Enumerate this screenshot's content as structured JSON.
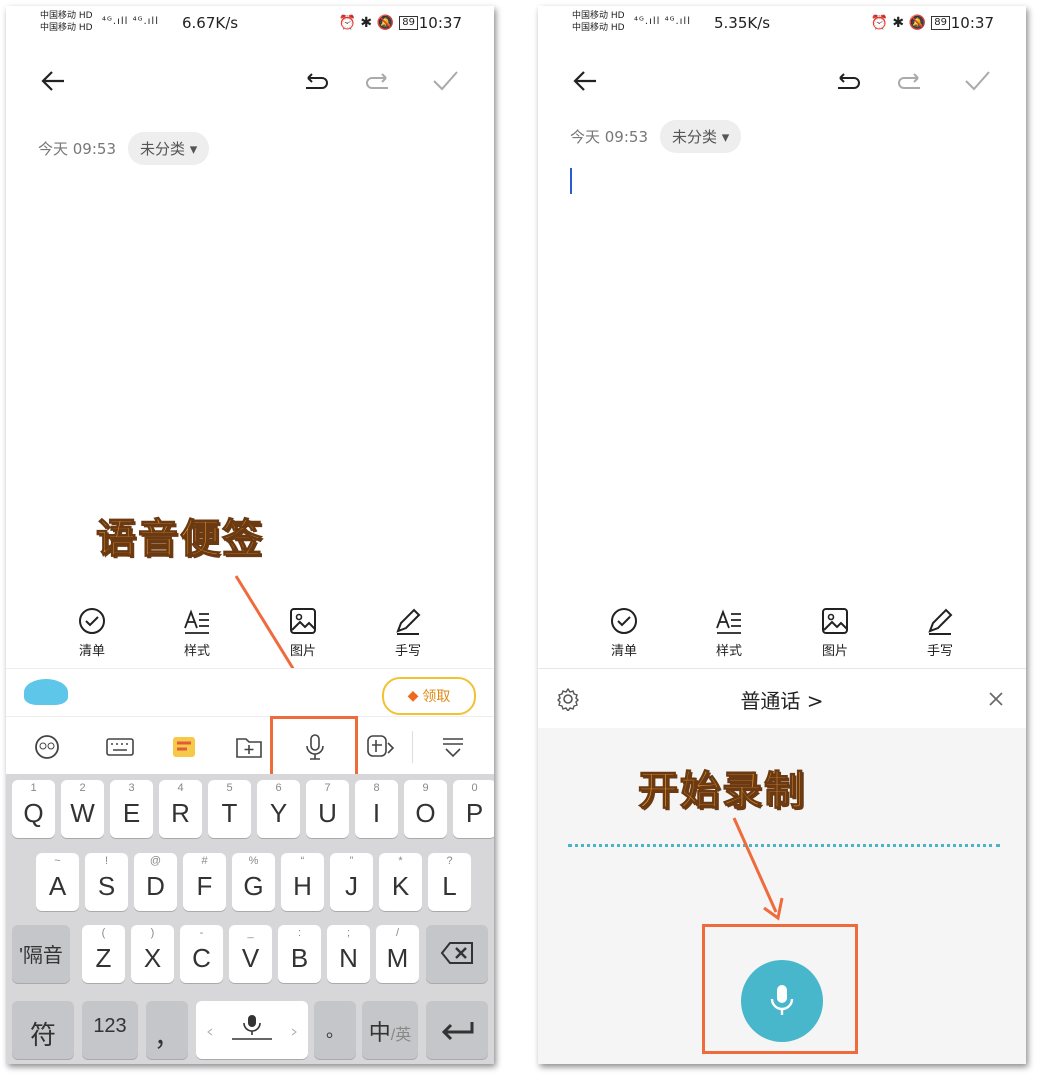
{
  "left": {
    "status": {
      "carrier1": "中国移动 HD",
      "carrier2": "中国移动 HD",
      "signal": "⁴ᴳ.ıll ⁴ᴳ.ıll",
      "speed": "6.67K/s",
      "icons": "⏰ ✱ 🔕",
      "battery": "89",
      "time": "10:37"
    },
    "note": {
      "date": "今天 09:53",
      "category": "未分类 ▾"
    },
    "tools": [
      "清单",
      "样式",
      "图片",
      "手写"
    ],
    "annotation": "语音便签",
    "promo": "领取",
    "keys_row1": [
      {
        "k": "Q",
        "n": "1"
      },
      {
        "k": "W",
        "n": "2"
      },
      {
        "k": "E",
        "n": "3"
      },
      {
        "k": "R",
        "n": "4"
      },
      {
        "k": "T",
        "n": "5"
      },
      {
        "k": "Y",
        "n": "6"
      },
      {
        "k": "U",
        "n": "7"
      },
      {
        "k": "I",
        "n": "8"
      },
      {
        "k": "O",
        "n": "9"
      },
      {
        "k": "P",
        "n": "0"
      }
    ],
    "keys_row2": [
      {
        "k": "A",
        "n": "~"
      },
      {
        "k": "S",
        "n": "!"
      },
      {
        "k": "D",
        "n": "@"
      },
      {
        "k": "F",
        "n": "#"
      },
      {
        "k": "G",
        "n": "%"
      },
      {
        "k": "H",
        "n": "“"
      },
      {
        "k": "J",
        "n": "”"
      },
      {
        "k": "K",
        "n": "*"
      },
      {
        "k": "L",
        "n": "?"
      }
    ],
    "keys_row3": [
      {
        "k": "Z",
        "n": "("
      },
      {
        "k": "X",
        "n": ")"
      },
      {
        "k": "C",
        "n": "-"
      },
      {
        "k": "V",
        "n": "_"
      },
      {
        "k": "B",
        "n": ":"
      },
      {
        "k": "N",
        "n": ";"
      },
      {
        "k": "M",
        "n": "/"
      }
    ],
    "key_separator": "'隔音",
    "key_symbol": "符",
    "key_123": "123",
    "key_comma": "，",
    "key_period": "。",
    "key_lang_main": "中",
    "key_lang_sub": "/英"
  },
  "right": {
    "status": {
      "carrier1": "中国移动 HD",
      "carrier2": "中国移动 HD",
      "signal": "⁴ᴳ.ıll ⁴ᴳ.ıll",
      "speed": "5.35K/s",
      "icons": "⏰ ✱ 🔕",
      "battery": "89",
      "time": "10:37"
    },
    "note": {
      "date": "今天 09:53",
      "category": "未分类 ▾"
    },
    "tools": [
      "清单",
      "样式",
      "图片",
      "手写"
    ],
    "voice": {
      "language": "普通话 >"
    },
    "annotation": "开始录制"
  },
  "colors": {
    "accent": "#49b7cb",
    "highlight": "#ef6b3b",
    "annotation": "#f1a331"
  }
}
